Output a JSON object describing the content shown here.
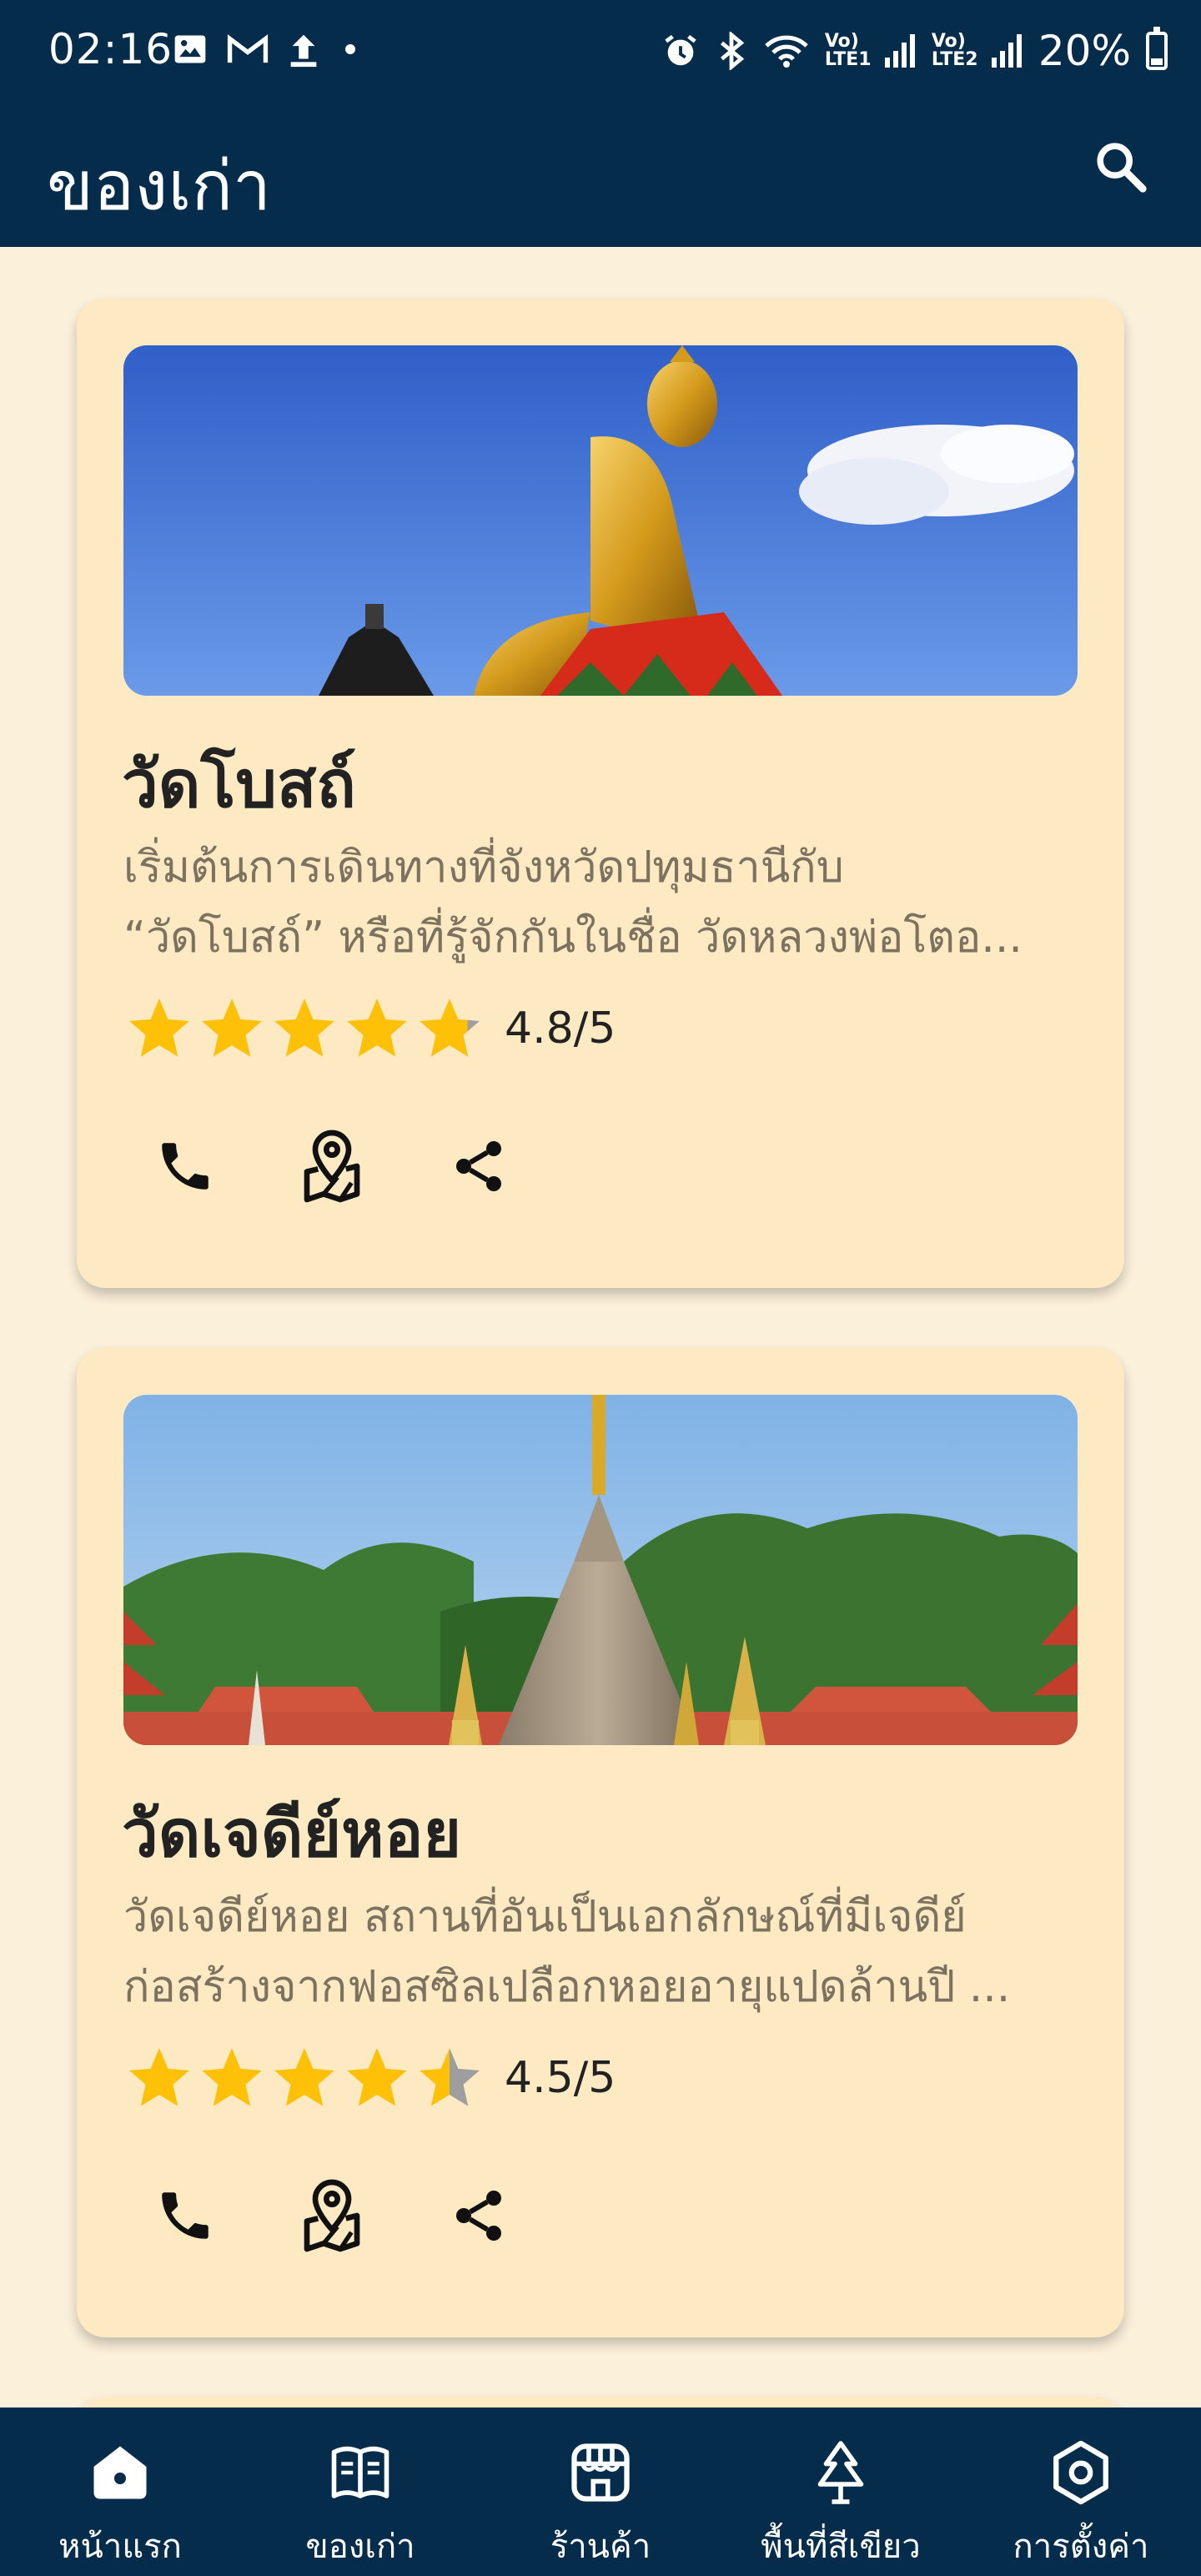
{
  "status_bar": {
    "time": "02:16",
    "network_1": "Vo) LTE1",
    "network_2": "Vo) LTE2",
    "battery_percent": "20%"
  },
  "app_bar": {
    "title": "ของเก่า",
    "search_icon": "search-icon"
  },
  "colors": {
    "header_bg": "#052d4b",
    "page_bg": "#fbf0da",
    "card_bg": "#fde9c2",
    "star": "#ffc107",
    "star_empty": "#9e9e9e"
  },
  "cards": [
    {
      "title": "วัดโบสถ์",
      "description_line1": "เริ่มต้นการเดินทางที่จังหวัดปทุมธานีกับ",
      "description_line2": "“วัดโบสถ์” หรือที่รู้จักกันในชื่อ วัดหลวงพ่อโตอ...",
      "rating_value": 4.8,
      "rating_text": "4.8/5",
      "actions": [
        "phone-icon",
        "map-pin-icon",
        "share-icon"
      ]
    },
    {
      "title": "วัดเจดีย์หอย",
      "description_line1": "วัดเจดีย์หอย สถานที่อันเป็นเอกลักษณ์ที่มีเจดีย์",
      "description_line2": "ก่อสร้างจากฟอสซิลเปลือกหอยอายุแปดล้านปี ...",
      "rating_value": 4.5,
      "rating_text": "4.5/5",
      "actions": [
        "phone-icon",
        "map-pin-icon",
        "share-icon"
      ]
    }
  ],
  "bottom_nav": {
    "items": [
      {
        "label": "หน้าแรก",
        "icon": "home-icon",
        "active": true
      },
      {
        "label": "ของเก่า",
        "icon": "book-icon",
        "active": false
      },
      {
        "label": "ร้านค้า",
        "icon": "store-icon",
        "active": false
      },
      {
        "label": "พื้นที่สีเขียว",
        "icon": "tree-icon",
        "active": false
      },
      {
        "label": "การตั้งค่า",
        "icon": "settings-icon",
        "active": false
      }
    ]
  }
}
